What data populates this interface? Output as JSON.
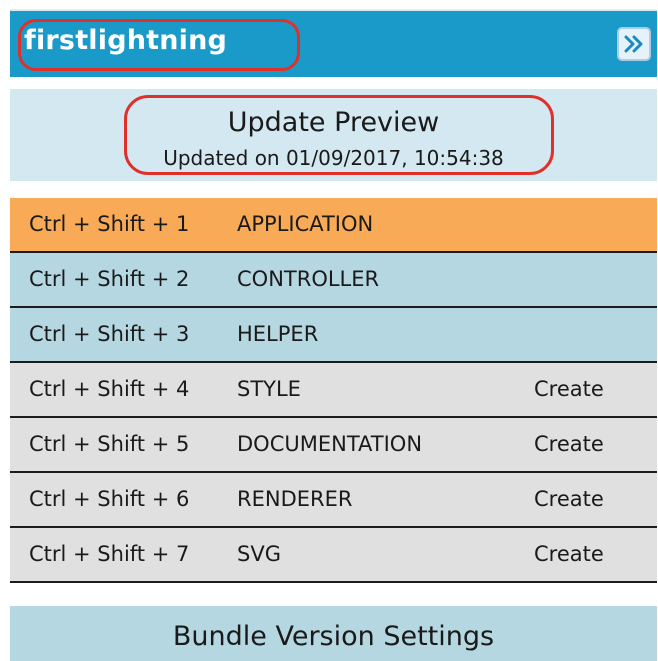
{
  "header": {
    "title": "firstlightning",
    "expand_icon": "double-chevron-right-icon",
    "background_color": "#1a9ac9",
    "highlight_color": "#e0302a"
  },
  "preview": {
    "title": "Update Preview",
    "updated_text": "Updated on 01/09/2017, 10:54:38",
    "background_color": "#d3e8f0"
  },
  "shortcuts": [
    {
      "keys": "Ctrl + Shift + 1",
      "label": "APPLICATION",
      "action": "",
      "state": "active"
    },
    {
      "keys": "Ctrl + Shift + 2",
      "label": "CONTROLLER",
      "action": "",
      "state": "exists"
    },
    {
      "keys": "Ctrl + Shift + 3",
      "label": "HELPER",
      "action": "",
      "state": "exists"
    },
    {
      "keys": "Ctrl + Shift + 4",
      "label": "STYLE",
      "action": "Create",
      "state": "missing"
    },
    {
      "keys": "Ctrl + Shift + 5",
      "label": "DOCUMENTATION",
      "action": "Create",
      "state": "missing"
    },
    {
      "keys": "Ctrl + Shift + 6",
      "label": "RENDERER",
      "action": "Create",
      "state": "missing"
    },
    {
      "keys": "Ctrl + Shift + 7",
      "label": "SVG",
      "action": "Create",
      "state": "missing"
    }
  ],
  "colors": {
    "active_row": "#f8aa57",
    "existing_row": "#b5d7e2",
    "missing_row": "#e0e0e0"
  },
  "bundle_settings": {
    "label": "Bundle Version Settings"
  }
}
